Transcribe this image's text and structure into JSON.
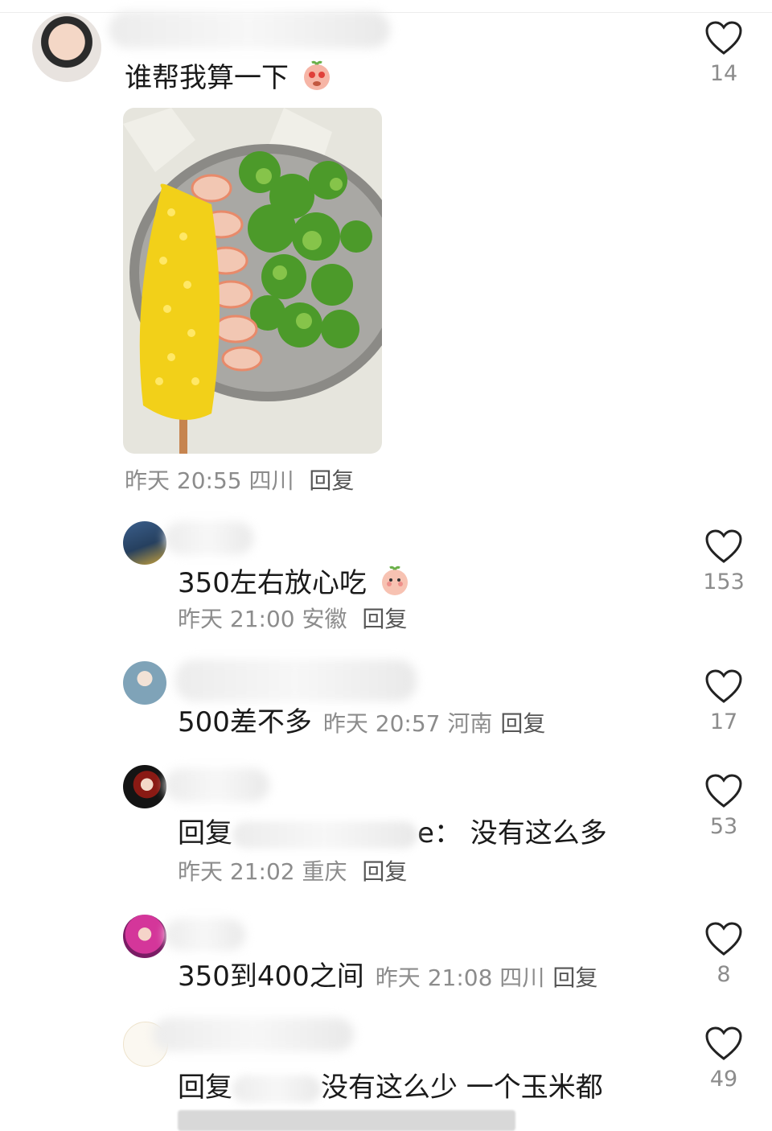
{
  "comments": [
    {
      "text": "谁帮我算一下",
      "time": "昨天 20:55",
      "region": "四川",
      "reply_label": "回复",
      "likes": "14"
    },
    {
      "text": "350左右放心吃",
      "time": "昨天 21:00",
      "region": "安徽",
      "reply_label": "回复",
      "likes": "153"
    },
    {
      "text": "500差不多",
      "time": "昨天 20:57",
      "region": "河南",
      "reply_label": "回复",
      "likes": "17"
    },
    {
      "text_prefix": "回复",
      "text_suffix": "e：  没有这么多",
      "time": "昨天 21:02",
      "region": "重庆",
      "reply_label": "回复",
      "likes": "53"
    },
    {
      "text": "350到400之间",
      "time": "昨天 21:08",
      "region": "四川",
      "reply_label": "回复",
      "likes": "8"
    },
    {
      "text_prefix": "回复",
      "text_suffix": "没有这么少 一个玉米都",
      "likes": "49"
    }
  ],
  "colors": {
    "meta_gray": "#8c8c8c",
    "heart_stroke": "#222222"
  },
  "icons": {
    "like": "heart-outline-icon",
    "emoji_a": "crying-face-emoji",
    "emoji_b": "blushing-face-emoji"
  }
}
